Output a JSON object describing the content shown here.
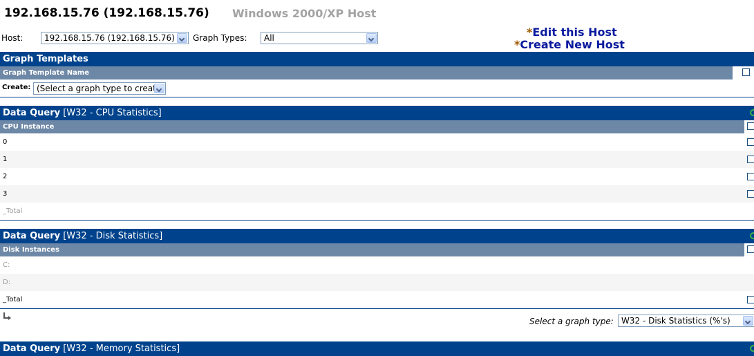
{
  "header": {
    "host_title": "192.168.15.76 (192.168.15.76)",
    "host_type": "Windows 2000/XP Host"
  },
  "filter": {
    "host_label": "Host:",
    "host_value": "192.168.15.76 (192.168.15.76)",
    "graph_types_label": "Graph Types:",
    "graph_types_value": "All"
  },
  "actions": {
    "star": "*",
    "edit_host": "Edit this Host",
    "create_host": "Create New Host"
  },
  "graph_templates": {
    "title": "Graph Templates",
    "column_header": "Graph Template Name",
    "create_label": "Create:",
    "create_value": "(Select a graph type to create)"
  },
  "cpu_query": {
    "prefix": "Data Query",
    "name": "[W32 - CPU Statistics]",
    "column_header": "CPU Instance",
    "rows": [
      "0",
      "1",
      "2",
      "3",
      "_Total"
    ]
  },
  "disk_query": {
    "prefix": "Data Query",
    "name": "[W32 - Disk Statistics]",
    "column_header": "Disk Instances",
    "rows": [
      "C:",
      "D:",
      "_Total"
    ],
    "select_graph_type_label": "Select a graph type:",
    "select_graph_type_value": "W32 - Disk Statistics (%'s)"
  },
  "memory_query": {
    "prefix": "Data Query",
    "name": "[W32 - Memory Statistics]"
  },
  "icons": [
    "chevron-down-icon",
    "checkbox-icon",
    "return-arrow-icon",
    "reload-circle-icon"
  ],
  "colors": {
    "header_bar": "#00438c",
    "sub_header": "#6d87a6",
    "link": "#0a1a9e",
    "star": "#a05a00",
    "reload": "#3db44a"
  }
}
